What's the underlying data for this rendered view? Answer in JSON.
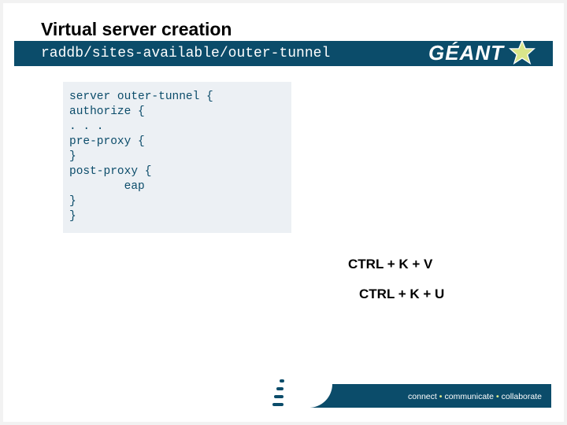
{
  "header": {
    "title": "Virtual server creation",
    "subtitle": "raddb/sites-available/outer-tunnel"
  },
  "logo": {
    "text": "GÉANT"
  },
  "code": "server outer-tunnel {\nauthorize {\n. . .\npre-proxy {\n}\npost-proxy {\n        eap\n}\n}",
  "shortcuts": {
    "first": "CTRL + K + V",
    "second": "CTRL + K + U"
  },
  "tagline": {
    "w1": "connect",
    "w2": "communicate",
    "w3": "collaborate",
    "sep": "•"
  }
}
